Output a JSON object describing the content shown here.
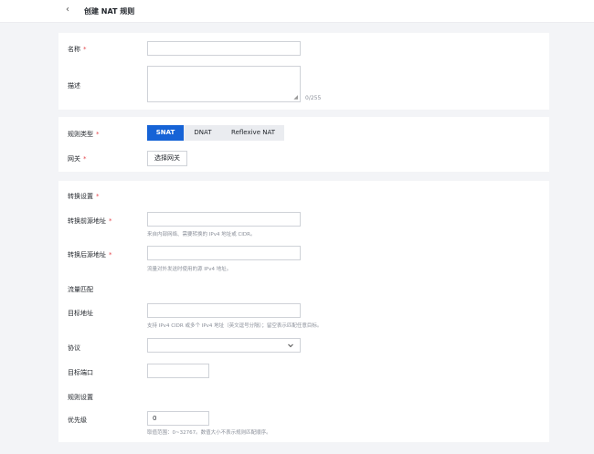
{
  "header": {
    "back_icon": "chevron-left-icon",
    "title": "创建 NAT 规则"
  },
  "basic": {
    "name_label": "名称",
    "required_mark": "*",
    "name_value": "",
    "desc_label": "描述",
    "desc_value": "",
    "desc_counter": "0/255"
  },
  "rule": {
    "type_label": "规则类型",
    "types": [
      "SNAT",
      "DNAT",
      "Reflexive NAT"
    ],
    "selected_type": "SNAT",
    "gateway_label": "网关",
    "gateway_button": "选择网关"
  },
  "conversion": {
    "section_label": "转换设置",
    "pre_label": "转换前源地址",
    "pre_value": "",
    "pre_hint": "来自内部网络、需要转换的 IPv4 地址或 CIDR。",
    "post_label": "转换后源地址",
    "post_value": "",
    "post_hint": "流量对外发送时使用的源 IPv4 地址。"
  },
  "match": {
    "section_label": "流量匹配",
    "dest_label": "目标地址",
    "dest_value": "",
    "dest_hint": "支持 IPv4 CIDR 或多个 IPv4 地址（英文逗号分隔）；留空表示匹配任意目标。",
    "protocol_label": "协议",
    "protocol_value": "",
    "port_label": "目标端口",
    "port_value": ""
  },
  "rule_settings": {
    "section_label": "规则设置",
    "priority_label": "优先级",
    "priority_value": "0",
    "priority_hint": "取值范围：0~32767。数值大小不表示规则匹配顺序。"
  },
  "colors": {
    "accent": "#1663d6",
    "required": "#e5484d",
    "page_bg": "#f3f4f7"
  }
}
